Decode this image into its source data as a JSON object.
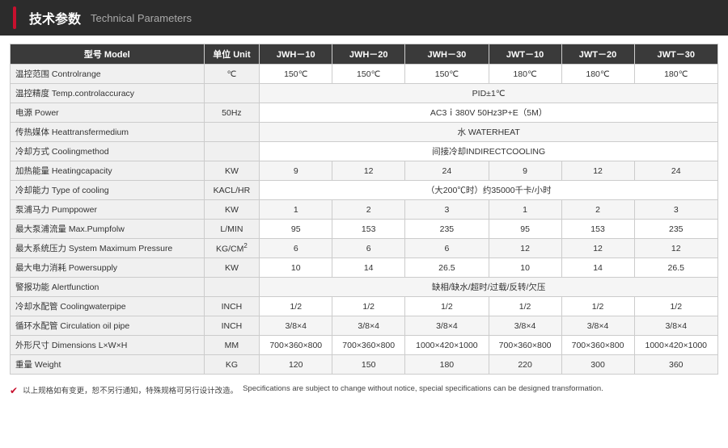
{
  "header": {
    "accent_color": "#c8102e",
    "title_cn": "技术参数",
    "title_en": "Technical Parameters"
  },
  "table": {
    "columns": [
      {
        "id": "model",
        "label_cn": "型号",
        "label_en": "Model"
      },
      {
        "id": "unit",
        "label_cn": "单位",
        "label_en": "Unit"
      },
      {
        "id": "jwh10",
        "label": "JWH－10"
      },
      {
        "id": "jwh20",
        "label": "JWH－20"
      },
      {
        "id": "jwh30",
        "label": "JWH－30"
      },
      {
        "id": "jwt10",
        "label": "JWT－10"
      },
      {
        "id": "jwt20",
        "label": "JWT－20"
      },
      {
        "id": "jwt30",
        "label": "JWT－30"
      }
    ],
    "rows": [
      {
        "label": "温控范围 Controlrange",
        "unit": "℃",
        "values": [
          "150℃",
          "150℃",
          "150℃",
          "180℃",
          "180℃",
          "180℃"
        ],
        "span": false
      },
      {
        "label": "温控精度 Temp.controlaccuracy",
        "unit": "",
        "span": true,
        "span_text": "PID±1℃"
      },
      {
        "label": "电源 Power",
        "unit": "50Hz",
        "span": true,
        "span_text": "AC3ｉ380V 50Hz3P+E（5M）"
      },
      {
        "label": "传热媒体 Heattransfermedium",
        "unit": "",
        "span": true,
        "span_text": "水 WATERHEAT"
      },
      {
        "label": "冷却方式 Coolingmethod",
        "unit": "",
        "span": true,
        "span_text": "间接冷却INDIRECTCOOLING"
      },
      {
        "label": "加热能量 Heatingcapacity",
        "unit": "KW",
        "values": [
          "9",
          "12",
          "24",
          "9",
          "12",
          "24"
        ],
        "span": false
      },
      {
        "label": "冷却能力 Type of cooling",
        "unit": "KACL/HR",
        "span": true,
        "span_text": "（大200℃时）约35000千卡/小时"
      },
      {
        "label": "泵浦马力 Pumppower",
        "unit": "KW",
        "values": [
          "1",
          "2",
          "3",
          "1",
          "2",
          "3"
        ],
        "span": false
      },
      {
        "label": "最大泵浦流量 Max.Pumpfolw",
        "unit": "L/MIN",
        "values": [
          "95",
          "153",
          "235",
          "95",
          "153",
          "235"
        ],
        "span": false
      },
      {
        "label": "最大系统压力 System Maximum Pressure",
        "unit": "KG/CM²",
        "values": [
          "6",
          "6",
          "6",
          "12",
          "12",
          "12"
        ],
        "span": false
      },
      {
        "label": "最大电力消耗 Powersupply",
        "unit": "KW",
        "values": [
          "10",
          "14",
          "26.5",
          "10",
          "14",
          "26.5"
        ],
        "span": false
      },
      {
        "label": "警报功能 Alertfunction",
        "unit": "",
        "span": true,
        "span_text": "缺相/缺水/超时/过载/反转/欠压"
      },
      {
        "label": "冷却水配管 Coolingwaterpipe",
        "unit": "INCH",
        "values": [
          "1/2",
          "1/2",
          "1/2",
          "1/2",
          "1/2",
          "1/2"
        ],
        "span": false
      },
      {
        "label": "循环水配管 Circulation oil pipe",
        "unit": "INCH",
        "values": [
          "3/8×4",
          "3/8×4",
          "3/8×4",
          "3/8×4",
          "3/8×4",
          "3/8×4"
        ],
        "span": false
      },
      {
        "label": "外形尺寸 Dimensions L×W×H",
        "unit": "MM",
        "values": [
          "700×360×800",
          "700×360×800",
          "1000×420×1000",
          "700×360×800",
          "700×360×800",
          "1000×420×1000"
        ],
        "span": false
      },
      {
        "label": "重量 Weight",
        "unit": "KG",
        "values": [
          "120",
          "150",
          "180",
          "220",
          "300",
          "360"
        ],
        "span": false
      }
    ]
  },
  "footer": {
    "icon": "✔",
    "note_cn": "以上规格如有变更，恕不另行通知，特殊规格可另行设计改造。",
    "note_en": "Specifications are subject to change without notice, special specifications can be designed transformation."
  }
}
